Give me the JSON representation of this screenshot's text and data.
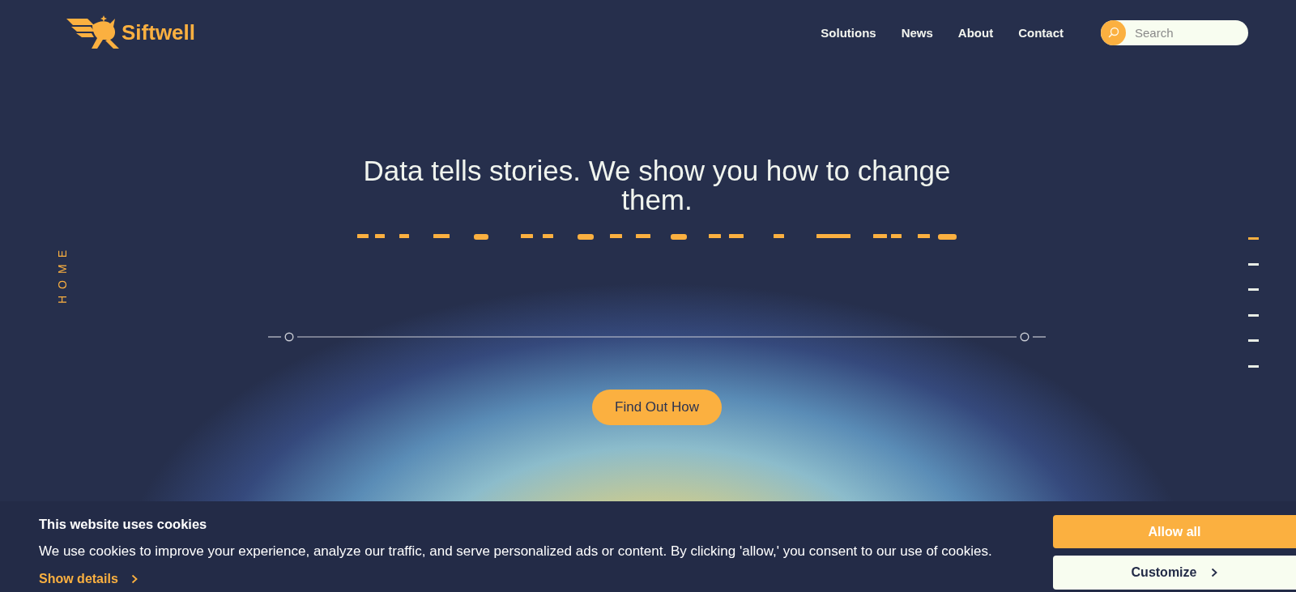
{
  "header": {
    "logo": "Siftwell",
    "nav": [
      "Solutions",
      "News",
      "About",
      "Contact"
    ],
    "search": {
      "placeholder": "Search"
    }
  },
  "side_label": "HOME",
  "hero": {
    "headline": "Data tells stories. We show you how to change them.",
    "button": "Find Out How"
  },
  "section_nav": [
    {
      "selected": true
    },
    {
      "selected": false
    },
    {
      "selected": false
    },
    {
      "selected": false
    },
    {
      "selected": false
    },
    {
      "selected": false
    }
  ],
  "cookie_banner": {
    "title": "This website uses cookies",
    "text": "We use cookies to improve your experience, analyze our traffic, and serve personalized ads or content. By clicking 'allow,' you consent to our use of cookies.",
    "details_link": "Show details",
    "buttons": [
      {
        "label": "Allow all",
        "kind": "primary"
      },
      {
        "label": "Customize",
        "kind": "secondary"
      }
    ]
  }
}
